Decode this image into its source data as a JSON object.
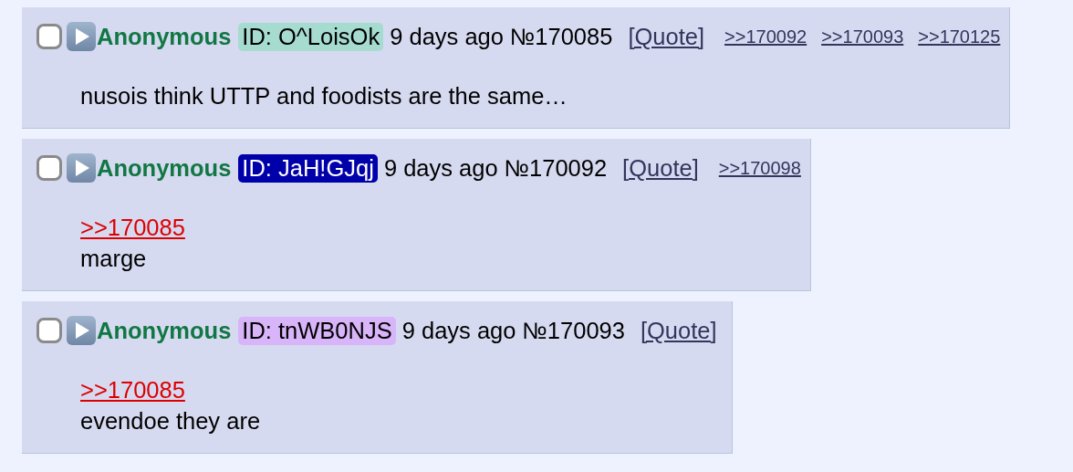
{
  "posts": [
    {
      "checked": false,
      "name": "Anonymous",
      "poster_id": "ID: O^LoisOk",
      "color": "#a6dcd0",
      "time": "9 days ago",
      "number": "№170085",
      "quote": "[Quote]",
      "backlinks": [
        ">>170092",
        ">>170093",
        ">>170125"
      ],
      "lines": [
        {
          "kind": "text",
          "text": "nusois think UTTP and foodists are the same…"
        }
      ]
    },
    {
      "checked": false,
      "name": "Anonymous",
      "poster_id": "ID: JaH!GJqj",
      "color": "#0000aa",
      "time": "9 days ago",
      "number": "№170092",
      "quote": "[Quote]",
      "backlinks": [
        ">>170098"
      ],
      "lines": [
        {
          "kind": "quotelink",
          "text": ">>170085"
        },
        {
          "kind": "text",
          "text": "marge"
        }
      ]
    },
    {
      "checked": false,
      "name": "Anonymous",
      "poster_id": "ID: tnWB0NJS",
      "color": "#d8b4f8",
      "time": "9 days ago",
      "number": "№170093",
      "quote": "[Quote]",
      "lines": [
        {
          "kind": "quotelink",
          "text": ">>170085"
        },
        {
          "kind": "text",
          "text": "evendoe they are"
        }
      ]
    }
  ]
}
